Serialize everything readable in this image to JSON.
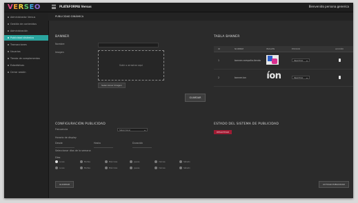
{
  "app": {
    "logo_letters": [
      "V",
      "E",
      "R",
      "S",
      "E",
      "O"
    ],
    "platform_name": "PLATAFORMA Versus",
    "welcome_text": "Bienvenido persona.generica"
  },
  "sidebar": {
    "items": [
      {
        "label": "Administrador Versus"
      },
      {
        "label": "Gestión de contenidos"
      },
      {
        "label": "Administración"
      },
      {
        "label": "Publicidad dinámica",
        "active": true
      },
      {
        "label": "Transacciones"
      },
      {
        "label": "Usuarios"
      },
      {
        "label": "Tienda de complementos"
      },
      {
        "label": "Estadísticas"
      },
      {
        "label": "Cerrar sesión"
      }
    ]
  },
  "breadcrumb": "PUBLICIDAD DINÁMICA",
  "banner_form": {
    "title": "BANNER",
    "name_label": "Nombre",
    "image_label": "Imagen",
    "drop_text": "Subir o arrastrar aquí",
    "select_image_button": "Seleccionar Imagen",
    "save_button": "GUARDAR"
  },
  "banner_table": {
    "title": "TABLA BANNER",
    "columns": [
      "ID",
      "NOMBRE",
      "IMAGEN",
      "ESTADO",
      "ACCIÓN"
    ],
    "rows": [
      {
        "id": "1",
        "name": "banner.campaña.tienda",
        "status": "INACTIVO"
      },
      {
        "id": "2",
        "name": "banner.ion",
        "thumb_text": "íon",
        "status": "INACTIVO"
      }
    ]
  },
  "config": {
    "title": "CONFIGURACIÓN PUBLICIDAD",
    "frequency_label": "Frecuencia",
    "frequency_value": "Seleccionar",
    "schedule_label": "Horario de display",
    "range_labels": [
      "Desde",
      "Hasta",
      "Duración"
    ],
    "extra_label": "Seleccionar días de la semana",
    "days_label": "Días",
    "radio_rows": [
      [
        "Lunes",
        "Martes",
        "Miércoles",
        "Jueves",
        "Viernes",
        "Sábado"
      ],
      [
        "Lunes",
        "Martes",
        "Miércoles",
        "Jueves",
        "Viernes",
        "Sábado",
        "Domingo"
      ]
    ],
    "save_button": "GUARDAR"
  },
  "system_status": {
    "title": "ESTADO DEL SISTEMA DE PUBLICIDAD",
    "deactivate_button": "DESACTIVAR",
    "bottom_button": "ACTIVAR PUBLICIDAD"
  },
  "colors": {
    "sidebar_active": "#2aa59f",
    "deactivate": "#a01c34",
    "background": "#2b2b2b"
  }
}
